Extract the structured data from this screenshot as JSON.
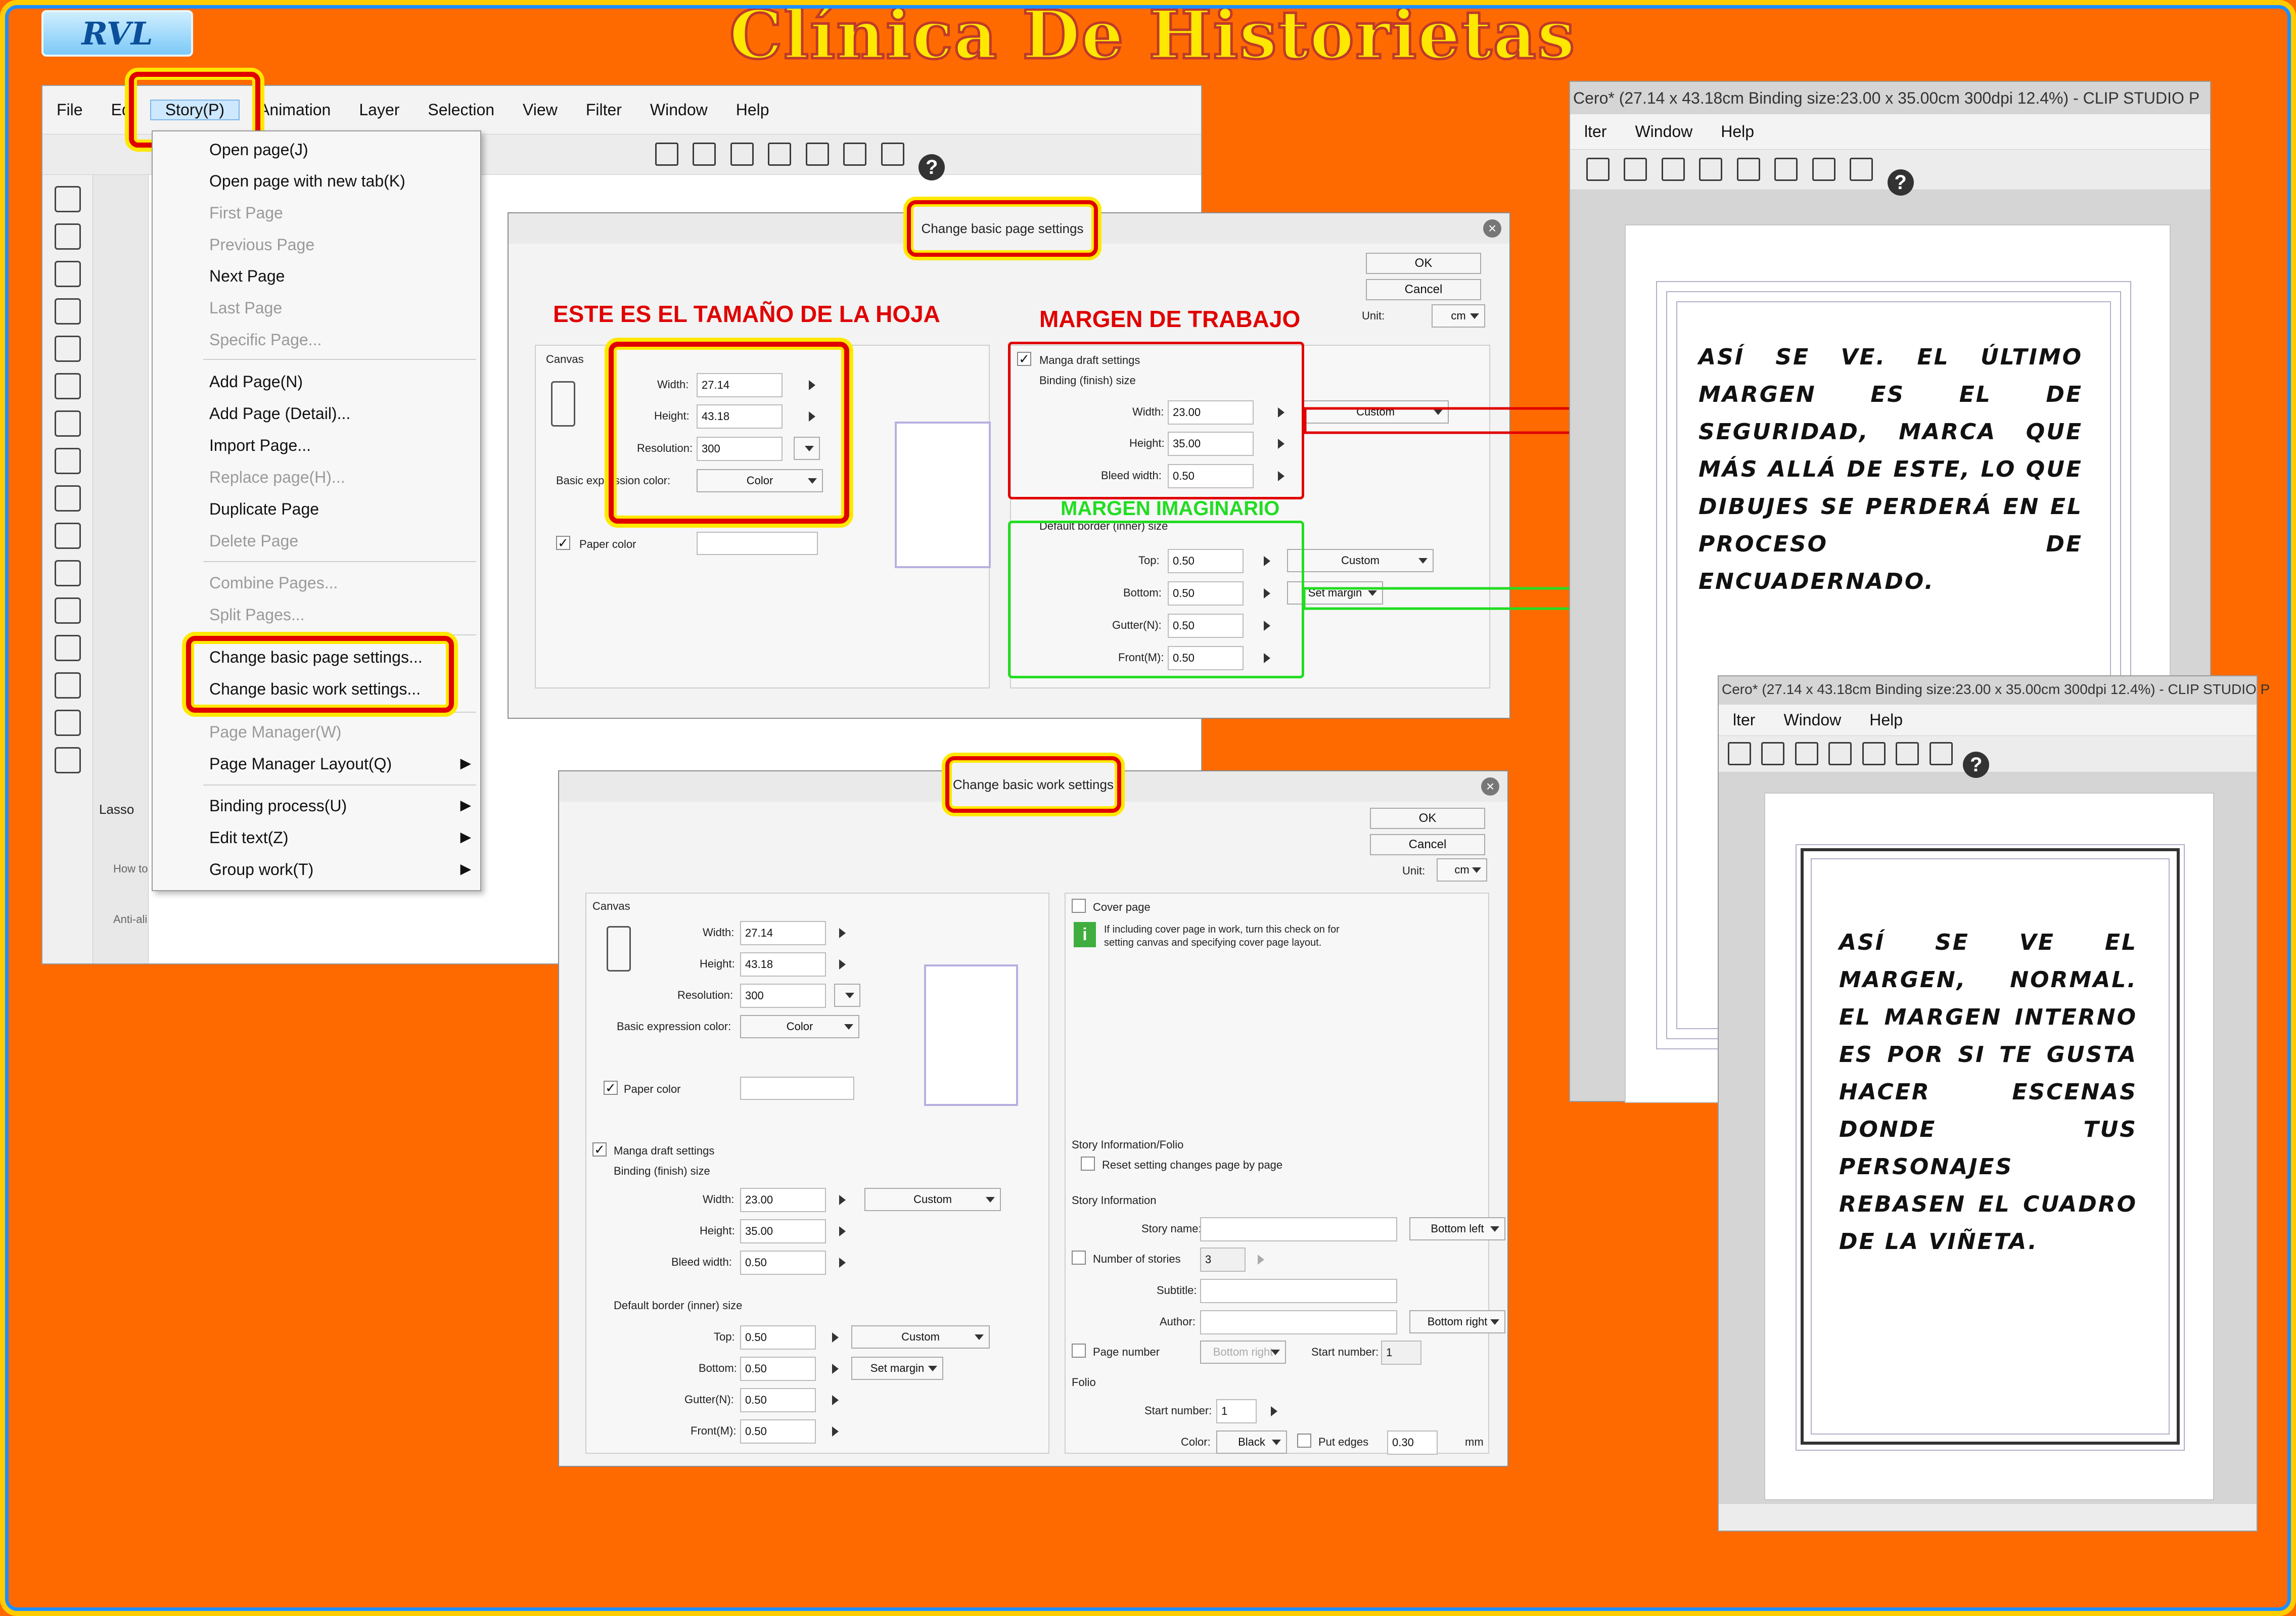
{
  "header": {
    "logo_text": "RVL",
    "title": "Clínica De Historietas"
  },
  "main_window": {
    "menu": [
      "File",
      "Ed",
      "Story(P)",
      "Animation",
      "Layer",
      "Selection",
      "View",
      "Filter",
      "Window",
      "Help"
    ],
    "tool_panel_label": "Lasso",
    "tool_hint_1": "How to",
    "tool_hint_2": "Anti-ali",
    "story_menu": {
      "items": [
        {
          "label": "Open page(J)",
          "disabled": false
        },
        {
          "label": "Open page with new tab(K)",
          "disabled": false
        },
        {
          "label": "First Page",
          "disabled": true
        },
        {
          "label": "Previous Page",
          "disabled": true
        },
        {
          "label": "Next Page",
          "disabled": false
        },
        {
          "label": "Last Page",
          "disabled": true
        },
        {
          "label": "Specific Page...",
          "disabled": true
        },
        {
          "label": "Add Page(N)",
          "disabled": false
        },
        {
          "label": "Add Page (Detail)...",
          "disabled": false
        },
        {
          "label": "Import Page...",
          "disabled": false
        },
        {
          "label": "Replace page(H)...",
          "disabled": true
        },
        {
          "label": "Duplicate Page",
          "disabled": false
        },
        {
          "label": "Delete Page",
          "disabled": true
        },
        {
          "label": "Combine Pages...",
          "disabled": true
        },
        {
          "label": "Split Pages...",
          "disabled": true
        },
        {
          "label": "Change basic page settings...",
          "disabled": false
        },
        {
          "label": "Change basic work settings...",
          "disabled": false
        },
        {
          "label": "Page Manager(W)",
          "disabled": true
        },
        {
          "label": "Page Manager Layout(Q)",
          "disabled": false
        },
        {
          "label": "Binding process(U)",
          "disabled": false
        },
        {
          "label": "Edit text(Z)",
          "disabled": false
        },
        {
          "label": "Group work(T)",
          "disabled": false
        }
      ]
    }
  },
  "page_dialog": {
    "title": "Change basic page settings",
    "ok": "OK",
    "cancel": "Cancel",
    "unit_label": "Unit:",
    "unit_value": "cm",
    "canvas_label": "Canvas",
    "width_label": "Width:",
    "width_value": "27.14",
    "height_label": "Height:",
    "height_value": "43.18",
    "resolution_label": "Resolution:",
    "resolution_value": "300",
    "basic_expr_label": "Basic expression color:",
    "color_value": "Color",
    "paper_color_label": "Paper color",
    "manga_label": "Manga draft settings",
    "binding_label": "Binding (finish) size",
    "b_width_value": "23.00",
    "b_height_value": "35.00",
    "bleed_label": "Bleed width:",
    "bleed_value": "0.50",
    "custom": "Custom",
    "default_border_label": "Default border (inner) size",
    "top_label": "Top:",
    "top_value": "0.50",
    "bottom_label": "Bottom:",
    "bottom_value": "0.50",
    "gutter_label": "Gutter(N):",
    "gutter_value": "0.50",
    "front_label": "Front(M):",
    "front_value": "0.50",
    "set_margin": "Set margin"
  },
  "annotations": {
    "sheet_size": "ESTE ES EL TAMAÑO DE LA HOJA",
    "work_margin": "MARGEN DE TRABAJO",
    "imaginary_margin": "MARGEN IMAGINARIO",
    "note_top": "ASÍ SE VE. EL ÚLTIMO MARGEN ES EL DE SEGURIDAD, MARCA QUE MÁS ALLÁ DE ESTE, LO QUE DIBUJES SE PERDERÁ EN EL PROCESO DE ENCUADERNADO.",
    "note_bottom": "ASÍ SE VE EL MARGEN, NORMAL. EL MARGEN INTERNO ES POR SI TE GUSTA HACER ESCENAS DONDE TUS PERSONAJES REBASEN EL CUADRO DE LA VIÑETA."
  },
  "work_dialog": {
    "title": "Change basic work settings",
    "ok": "OK",
    "cancel": "Cancel",
    "unit_label": "Unit:",
    "unit_value": "cm",
    "canvas_label": "Canvas",
    "width_label": "Width:",
    "width_value": "27.14",
    "height_label": "Height:",
    "height_value": "43.18",
    "resolution_label": "Resolution:",
    "resolution_value": "300",
    "basic_expr_label": "Basic expression color:",
    "color_value": "Color",
    "paper_color_label": "Paper color",
    "manga_label": "Manga draft settings",
    "binding_label": "Binding (finish) size",
    "b_width_value": "23.00",
    "b_height_value": "35.00",
    "bleed_label": "Bleed width:",
    "bleed_value": "0.50",
    "custom": "Custom",
    "default_border_label": "Default border (inner) size",
    "top_label": "Top:",
    "top_value": "0.50",
    "bottom_label": "Bottom:",
    "bottom_value": "0.50",
    "gutter_label": "Gutter(N):",
    "gutter_value": "0.50",
    "front_label": "Front(M):",
    "front_value": "0.50",
    "set_margin": "Set margin",
    "cover_label": "Cover page",
    "cover_info": "If including cover page in work, turn this check on for setting canvas and specifying cover page layout.",
    "story_info_folio": "Story Information/Folio",
    "reset_setting": "Reset setting changes page by page",
    "story_info": "Story Information",
    "story_name_label": "Story name:",
    "bottom_left": "Bottom left",
    "num_stories_label": "Number of stories",
    "num_stories_value": "3",
    "subtitle_label": "Subtitle:",
    "author_label": "Author:",
    "bottom_right": "Bottom right",
    "page_number_label": "Page number",
    "bottom_right_dis": "Bottom right",
    "start_number_label": "Start number:",
    "start_number_value": "1",
    "folio_label": "Folio",
    "folio_start_value": "1",
    "color_label": "Color:",
    "black_value": "Black",
    "put_edges_label": "Put edges",
    "edges_value": "0.30",
    "mm_label": "mm"
  },
  "preview_top": {
    "title": "Cero* (27.14 x 43.18cm Binding size:23.00 x 35.00cm 300dpi 12.4%) - CLIP STUDIO P",
    "menu": [
      "lter",
      "Window",
      "Help"
    ]
  },
  "preview_bottom": {
    "title": "Cero* (27.14 x 43.18cm Binding size:23.00 x 35.00cm 300dpi 12.4%) - CLIP STUDIO P",
    "menu": [
      "lter",
      "Window",
      "Help"
    ]
  },
  "colors": {
    "background": "#ff6a00",
    "highlight_red": "#e00000",
    "highlight_yellow": "#ffe800",
    "work_margin_red": "#e00000",
    "imaginary_green": "#22dd22"
  }
}
